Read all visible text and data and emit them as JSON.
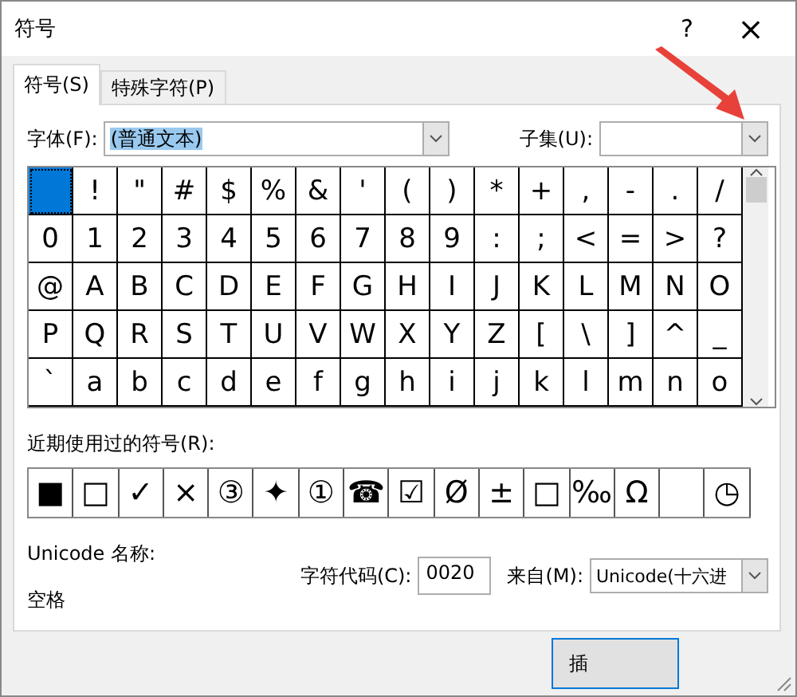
{
  "window": {
    "title": "符号",
    "help": "?",
    "close": "×"
  },
  "tabs": [
    {
      "label": "符号(S)",
      "selected": true
    },
    {
      "label": "特殊字符(P)",
      "selected": false
    }
  ],
  "font": {
    "label": "字体(F):",
    "value": "(普通文本)"
  },
  "subset": {
    "label": "子集(U):"
  },
  "grid": [
    [
      {
        "selected": true
      },
      {
        "char": "!",
        "selected": false
      },
      {
        "char": "\"",
        "selected": false
      },
      {
        "char": "#",
        "selected": false
      },
      {
        "char": "$",
        "selected": false
      },
      {
        "char": "%",
        "selected": false
      },
      {
        "char": "&",
        "selected": false
      },
      {
        "char": "'",
        "selected": false
      },
      {
        "char": "(",
        "selected": false
      },
      {
        "char": ")",
        "selected": false
      },
      {
        "char": "*",
        "selected": false
      },
      {
        "char": "+",
        "selected": false
      },
      {
        "char": ",",
        "selected": false
      },
      {
        "char": "-",
        "selected": false
      },
      {
        "char": ".",
        "selected": false
      },
      {
        "char": "/",
        "selected": false
      }
    ],
    [
      {
        "char": "0",
        "selected": false
      },
      {
        "char": "1",
        "selected": false
      },
      {
        "char": "2",
        "selected": false
      },
      {
        "char": "3",
        "selected": false
      },
      {
        "char": "4",
        "selected": false
      },
      {
        "char": "5",
        "selected": false
      },
      {
        "char": "6",
        "selected": false
      },
      {
        "char": "7",
        "selected": false
      },
      {
        "char": "8",
        "selected": false
      },
      {
        "char": "9",
        "selected": false
      },
      {
        "char": ":",
        "selected": false
      },
      {
        "char": ";",
        "selected": false
      },
      {
        "char": "<",
        "selected": false
      },
      {
        "char": "=",
        "selected": false
      },
      {
        "char": ">",
        "selected": false
      },
      {
        "char": "?",
        "selected": false
      }
    ],
    [
      {
        "char": "@",
        "selected": false
      },
      {
        "char": "A",
        "selected": false
      },
      {
        "char": "B",
        "selected": false
      },
      {
        "char": "C",
        "selected": false
      },
      {
        "char": "D",
        "selected": false
      },
      {
        "char": "E",
        "selected": false
      },
      {
        "char": "F",
        "selected": false
      },
      {
        "char": "G",
        "selected": false
      },
      {
        "char": "H",
        "selected": false
      },
      {
        "char": "I",
        "selected": false
      },
      {
        "char": "J",
        "selected": false
      },
      {
        "char": "K",
        "selected": false
      },
      {
        "char": "L",
        "selected": false
      },
      {
        "char": "M",
        "selected": false
      },
      {
        "char": "N",
        "selected": false
      },
      {
        "char": "O",
        "selected": false
      }
    ],
    [
      {
        "char": "P",
        "selected": false
      },
      {
        "char": "Q",
        "selected": false
      },
      {
        "char": "R",
        "selected": false
      },
      {
        "char": "S",
        "selected": false
      },
      {
        "char": "T",
        "selected": false
      },
      {
        "char": "U",
        "selected": false
      },
      {
        "char": "V",
        "selected": false
      },
      {
        "char": "W",
        "selected": false
      },
      {
        "char": "X",
        "selected": false
      },
      {
        "char": "Y",
        "selected": false
      },
      {
        "char": "Z",
        "selected": false
      },
      {
        "char": "[",
        "selected": false
      },
      {
        "char": "\\",
        "selected": false
      },
      {
        "char": "]",
        "selected": false
      },
      {
        "char": "^",
        "selected": false
      },
      {
        "char": "_",
        "selected": false
      }
    ],
    [
      {
        "char": "`",
        "selected": false
      },
      {
        "char": "a",
        "selected": false
      },
      {
        "char": "b",
        "selected": false
      },
      {
        "char": "c",
        "selected": false
      },
      {
        "char": "d",
        "selected": false
      },
      {
        "char": "e",
        "selected": false
      },
      {
        "char": "f",
        "selected": false
      },
      {
        "char": "g",
        "selected": false
      },
      {
        "char": "h",
        "selected": false
      },
      {
        "char": "i",
        "selected": false
      },
      {
        "char": "j",
        "selected": false
      },
      {
        "char": "k",
        "selected": false
      },
      {
        "char": "l",
        "selected": false
      },
      {
        "char": "m",
        "selected": false
      },
      {
        "char": "n",
        "selected": false
      },
      {
        "char": "o",
        "selected": false
      }
    ]
  ],
  "recent": {
    "label": "近期使用过的符号(R):",
    "symbols": [
      {
        "kind": "symbol",
        "char": "■"
      },
      {
        "kind": "symbol",
        "char": "□"
      },
      {
        "kind": "symbol",
        "char": "✓"
      },
      {
        "kind": "symbol",
        "char": "×"
      },
      {
        "kind": "symbol",
        "char": "③"
      },
      {
        "kind": "symbol",
        "char": "✦"
      },
      {
        "kind": "symbol",
        "char": "①"
      },
      {
        "kind": "symbol",
        "char": "☎"
      },
      {
        "kind": "symbol",
        "char": "☑"
      },
      {
        "kind": "symbol",
        "char": "Ø"
      },
      {
        "kind": "symbol",
        "char": "±"
      },
      {
        "kind": "symbol",
        "char": "□"
      },
      {
        "kind": "symbol",
        "char": "‰"
      },
      {
        "kind": "symbol",
        "char": "Ω"
      },
      {
        "kind": "blank"
      },
      {
        "kind": "symbol",
        "char": "◷"
      }
    ]
  },
  "unicode_name": {
    "label": "Unicode 名称:",
    "value": "空格"
  },
  "char_code": {
    "label": "字符代码(C):",
    "value": "0020"
  },
  "from": {
    "label": "来自(M):",
    "value": "Unicode(十六进"
  },
  "buttons": [
    "插"
  ]
}
